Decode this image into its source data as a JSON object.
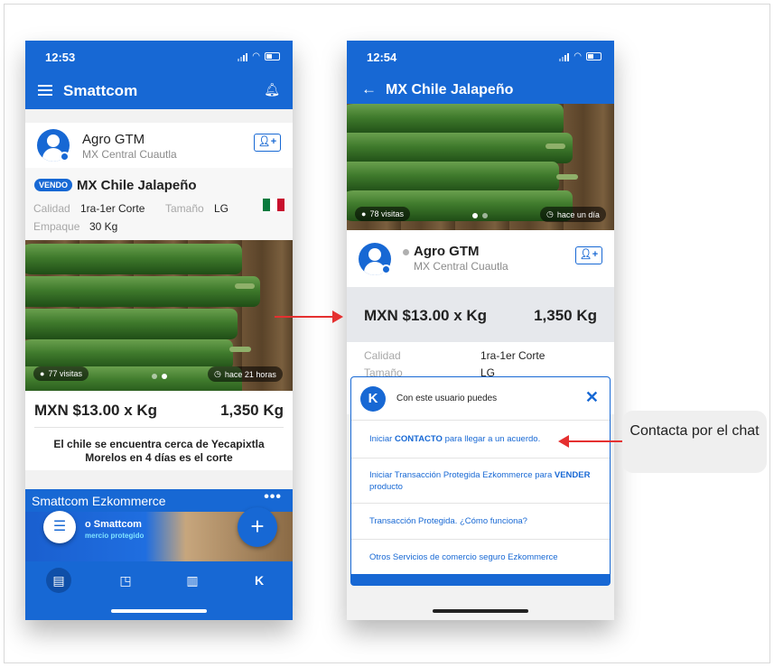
{
  "colors": {
    "primary": "#1768d4",
    "arrow": "#e53030"
  },
  "phone1": {
    "time": "12:53",
    "app_title": "Smattcom",
    "seller": {
      "name": "Agro GTM",
      "location": "MX Central Cuautla"
    },
    "badge": "VENDO",
    "product_title": "MX Chile Jalapeño",
    "specs": {
      "calidad_label": "Calidad",
      "calidad_value": "1ra-1er Corte",
      "tamano_label": "Tamaño",
      "tamano_value": "LG",
      "empaque_label": "Empaque",
      "empaque_value": "30 Kg"
    },
    "visits": "77 visitas",
    "time_ago": "hace 21 horas",
    "price": "MXN $13.00 x Kg",
    "quantity": "1,350 Kg",
    "description": "El chile se encuentra cerca de Yecapixtla Morelos en 4 días es el corte",
    "promo_title": "Smattcom Ezkommerce",
    "promo_text": "o Smattcom",
    "promo_sub": "mercio protegido",
    "icons": [
      "menu-icon",
      "bell-icon",
      "follow-user-icon",
      "eye-icon",
      "clock-icon",
      "filter-icon",
      "plus-icon",
      "list-icon",
      "chart-icon",
      "document-icon",
      "k-icon"
    ]
  },
  "phone2": {
    "time": "12:54",
    "title": "MX Chile Jalapeño",
    "visits": "78 visitas",
    "time_ago": "hace un día",
    "seller": {
      "name": "Agro GTM",
      "location": "MX Central Cuautla"
    },
    "price": "MXN $13.00 x Kg",
    "quantity": "1,350 Kg",
    "calidad_label": "Calidad",
    "calidad_value": "1ra-1er Corte",
    "tamano_label": "Tamaño",
    "tamano_value": "LG",
    "modal": {
      "title": "Con este usuario puedes",
      "options": [
        {
          "pre": "Iniciar ",
          "bold": "CONTACTO",
          "post": " para llegar a un acuerdo."
        },
        {
          "pre": "Iniciar Transacción Protegida Ezkommerce para ",
          "bold": "VENDER",
          "post": " producto"
        },
        {
          "pre": "Transacción Protegida. ¿Cómo funciona?",
          "bold": "",
          "post": ""
        },
        {
          "pre": "Otros Servicios de comercio seguro Ezkommerce",
          "bold": "",
          "post": ""
        }
      ]
    }
  },
  "callout": {
    "text": "Contacta por el chat"
  }
}
